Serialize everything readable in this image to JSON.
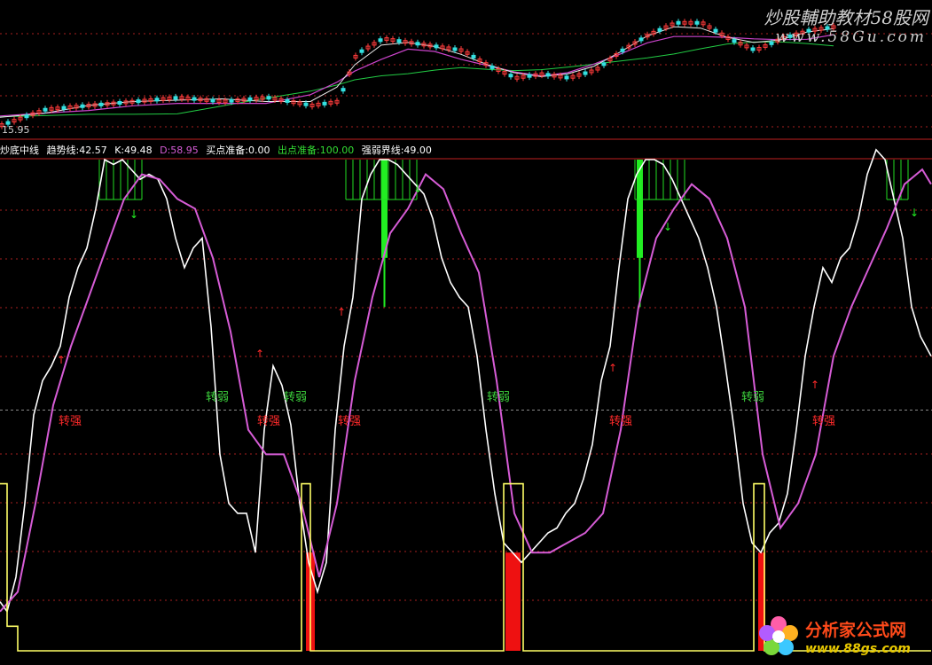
{
  "watermark": {
    "title": "炒股輔助教材58股网",
    "url": "www.58Gu.com"
  },
  "price_panel": {
    "low_label": "15.95"
  },
  "legend": {
    "name": "炒底中线",
    "items": [
      {
        "text": "趋势线:42.57",
        "color": "#ffffff"
      },
      {
        "text": "K:49.48",
        "color": "#ffffff"
      },
      {
        "text": "D:58.95",
        "color": "#d65cd6"
      },
      {
        "text": "买点准备:0.00",
        "color": "#ffffff"
      },
      {
        "text": "出点准备:100.00",
        "color": "#33dd33"
      },
      {
        "text": "强弱界线:49.00",
        "color": "#ffffff"
      }
    ]
  },
  "bottom_watermark": {
    "title": "分析家公式网",
    "url": "www.88gs.com"
  },
  "signals": [
    {
      "text": "转弱",
      "color": "#3cd23c"
    },
    {
      "text": "转弱",
      "color": "#3cd23c"
    },
    {
      "text": "转弱",
      "color": "#3cd23c"
    },
    {
      "text": "转弱",
      "color": "#3cd23c"
    },
    {
      "text": "转强",
      "color": "#ff2a2a"
    },
    {
      "text": "转强",
      "color": "#ff2a2a"
    },
    {
      "text": "转强",
      "color": "#ff2a2a"
    },
    {
      "text": "转强",
      "color": "#ff2a2a"
    },
    {
      "text": "转强",
      "color": "#ff2a2a"
    }
  ],
  "colors": {
    "k": "#ffffff",
    "d": "#d65cd6",
    "buy": "#ffff66",
    "sell_bar": "#22ee22",
    "buy_bar": "#ee1111",
    "grid": "#a82020"
  },
  "chart_data": [
    {
      "type": "line",
      "xlim": [
        0,
        1050
      ],
      "ylim": [
        0,
        100
      ],
      "hline": 49,
      "series": [
        {
          "name": "K",
          "x": [
            0,
            8,
            18,
            28,
            38,
            48,
            58,
            68,
            78,
            88,
            98,
            108,
            118,
            128,
            138,
            148,
            158,
            168,
            178,
            188,
            198,
            208,
            218,
            228,
            238,
            248,
            258,
            268,
            278,
            288,
            298,
            308,
            318,
            328,
            338,
            348,
            358,
            368,
            378,
            388,
            398,
            408,
            418,
            428,
            438,
            448,
            458,
            468,
            478,
            488,
            498,
            508,
            518,
            528,
            538,
            548,
            558,
            568,
            578,
            588,
            598,
            608,
            618,
            628,
            638,
            648,
            658,
            668,
            678,
            688,
            698,
            708,
            718,
            728,
            738,
            748,
            758,
            768,
            778,
            788,
            798,
            808,
            818,
            828,
            838,
            848,
            858,
            868,
            878,
            888,
            898,
            908,
            918,
            928,
            938,
            948,
            958,
            968,
            978,
            988,
            998,
            1008,
            1018,
            1028,
            1038,
            1050
          ],
          "values": [
            10,
            8,
            15,
            30,
            48,
            55,
            58,
            62,
            72,
            78,
            82,
            90,
            100,
            99,
            100,
            98,
            96,
            97,
            96,
            92,
            84,
            78,
            82,
            84,
            66,
            40,
            30,
            28,
            28,
            20,
            45,
            58,
            54,
            46,
            30,
            18,
            12,
            18,
            45,
            62,
            72,
            92,
            97,
            100,
            100,
            99,
            97,
            95,
            93,
            88,
            80,
            75,
            72,
            70,
            60,
            45,
            32,
            22,
            20,
            18,
            20,
            22,
            24,
            25,
            28,
            30,
            35,
            42,
            55,
            62,
            78,
            92,
            97,
            100,
            100,
            99,
            96,
            92,
            88,
            84,
            78,
            70,
            58,
            45,
            30,
            22,
            20,
            24,
            26,
            32,
            45,
            60,
            70,
            78,
            75,
            80,
            82,
            88,
            97,
            102,
            100,
            92,
            84,
            70,
            64,
            60
          ]
        },
        {
          "name": "D",
          "x": [
            0,
            20,
            40,
            60,
            80,
            100,
            120,
            140,
            160,
            180,
            200,
            220,
            240,
            260,
            280,
            300,
            320,
            340,
            360,
            380,
            400,
            420,
            440,
            460,
            480,
            500,
            520,
            540,
            560,
            580,
            600,
            620,
            640,
            660,
            680,
            700,
            720,
            740,
            760,
            780,
            800,
            820,
            840,
            860,
            880,
            900,
            920,
            940,
            960,
            980,
            1000,
            1020,
            1040,
            1050
          ],
          "values": [
            8,
            12,
            30,
            50,
            62,
            72,
            82,
            92,
            97,
            96,
            92,
            90,
            80,
            65,
            45,
            40,
            40,
            30,
            15,
            30,
            55,
            72,
            85,
            90,
            97,
            94,
            85,
            77,
            55,
            28,
            20,
            20,
            22,
            24,
            28,
            45,
            70,
            84,
            90,
            95,
            92,
            84,
            70,
            40,
            25,
            30,
            40,
            60,
            70,
            78,
            86,
            95,
            98,
            95
          ],
          "color": "#d65cd6"
        },
        {
          "name": "买点准备",
          "x": [
            0,
            8,
            8,
            20,
            20,
            340,
            340,
            350,
            350,
            568,
            568,
            590,
            590,
            850,
            850,
            862,
            862,
            1050
          ],
          "values": [
            34,
            34,
            5,
            5,
            0,
            0,
            34,
            34,
            0,
            0,
            34,
            34,
            0,
            0,
            34,
            34,
            0,
            0
          ],
          "color": "#ffff66"
        }
      ],
      "bars": [
        {
          "name": "出点准备",
          "x": [
            430,
            437
          ],
          "color": "#22ee22"
        },
        {
          "name": "出点准备",
          "x": [
            718,
            725
          ],
          "color": "#22ee22"
        },
        {
          "name": "买点",
          "x": [
            345,
            355
          ],
          "color": "#ee1111"
        },
        {
          "name": "买点",
          "x": [
            570,
            587
          ],
          "color": "#ee1111"
        },
        {
          "name": "买点",
          "x": [
            855,
            863
          ],
          "color": "#ee1111"
        }
      ]
    },
    {
      "type": "line",
      "xlim": [
        0,
        1050
      ],
      "series": [
        {
          "name": "price",
          "x": [
            0,
            50,
            100,
            150,
            200,
            250,
            300,
            350,
            380,
            400,
            430,
            460,
            490,
            520,
            550,
            580,
            610,
            640,
            670,
            700,
            730,
            760,
            790,
            820,
            850,
            880,
            910,
            940
          ],
          "values": [
            16.0,
            16.4,
            16.5,
            16.6,
            16.7,
            16.6,
            16.7,
            16.5,
            16.6,
            17.8,
            18.2,
            18.1,
            18.0,
            17.9,
            17.5,
            17.2,
            17.3,
            17.2,
            17.4,
            17.9,
            18.3,
            18.6,
            18.6,
            18.2,
            17.9,
            18.2,
            18.4,
            18.5
          ]
        }
      ]
    }
  ]
}
